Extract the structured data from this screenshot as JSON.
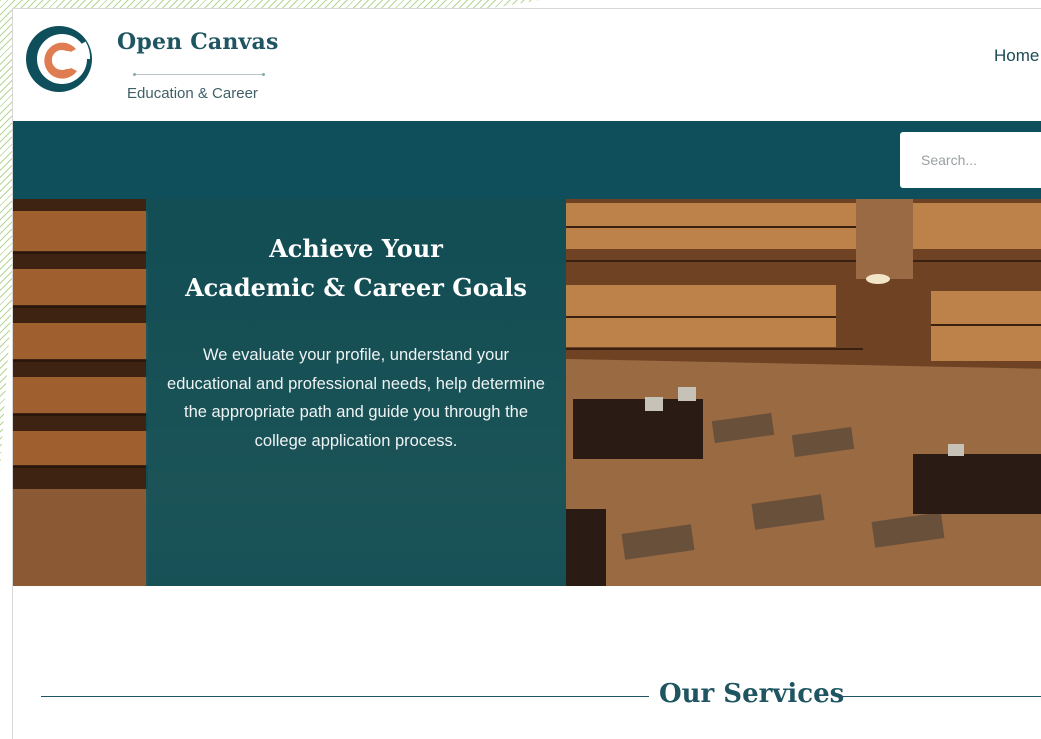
{
  "header": {
    "brand_name": "Open Canvas",
    "tagline": "Education & Career",
    "nav": {
      "home": "Home"
    }
  },
  "search": {
    "placeholder": "Search..."
  },
  "hero": {
    "title_line1": "Achieve Your",
    "title_line2": "Academic & Career Goals",
    "description": "We evaluate your profile, understand your educational and professional needs, help determine the appropriate path and guide you through the college application process."
  },
  "services": {
    "title": "Our Services"
  },
  "colors": {
    "brand_teal": "#0f4f5c",
    "heading_teal": "#1f5561",
    "logo_orange": "#e07c52",
    "accent_green": "#78b43c"
  },
  "icons": {
    "logo": "open-canvas-logo-icon"
  }
}
